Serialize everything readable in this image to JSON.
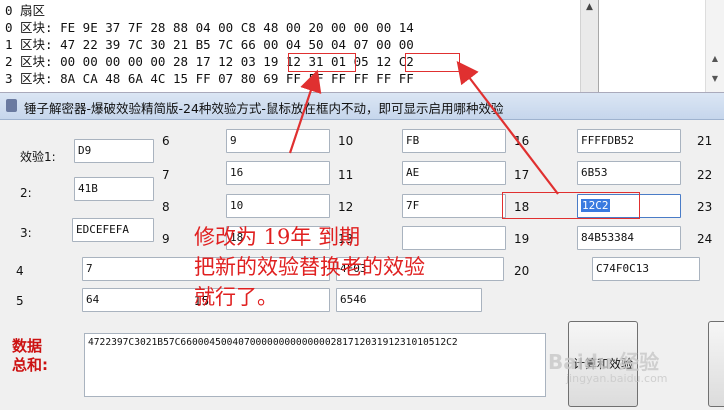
{
  "dump": {
    "lines": [
      "0 扇区",
      "0 区块: FE 9E 37 7F 28 88 04 00 C8 48 00 20 00 00 00 14",
      "1 区块: 47 22 39 7C 30 21 B5 7C 66 00 04 50 04 07 00 00",
      "2 区块: 00 00 00 00 00 28 17 12 03 19 12 31 01 05 12 C2",
      "3 区块: 8A CA 48 6A 4C 15 FF 07 80 69 FF FF FF FF FF FF"
    ]
  },
  "window": {
    "title": "锤子解密器-爆破效验精简版-24种效验方式-鼠标放在框内不动，即可显示启用哪种效验"
  },
  "fields": {
    "f1": {
      "label": "效验1:",
      "value": "D9"
    },
    "f2": {
      "label": "2:",
      "value": "41B"
    },
    "f3": {
      "label": "3:",
      "value": "EDCEFEFA"
    },
    "f4": {
      "label": "4",
      "value": "7"
    },
    "f5": {
      "label": "5",
      "value": "64"
    },
    "f6": {
      "label": "6",
      "value": "9"
    },
    "f7": {
      "label": "7",
      "value": "16"
    },
    "f8": {
      "label": "8",
      "value": "10"
    },
    "f9": {
      "label": "9",
      "value": "18"
    },
    "f10": {
      "label": "10",
      "value": "FB"
    },
    "f11": {
      "label": "11",
      "value": "AE"
    },
    "f12": {
      "label": "12",
      "value": "7F"
    },
    "f13": {
      "label": "13",
      "value": ""
    },
    "f14": {
      "label": "14",
      "value": "4F03"
    },
    "f15": {
      "label": "15",
      "value": "6546"
    },
    "f16": {
      "label": "16",
      "value": "FFFFDB52"
    },
    "f17": {
      "label": "17",
      "value": "6B53"
    },
    "f18": {
      "label": "18",
      "value": "12C2"
    },
    "f19": {
      "label": "19",
      "value": "84B53384"
    },
    "f20": {
      "label": "20",
      "value": "C74F0C13"
    },
    "f21": {
      "label": "21"
    },
    "f22": {
      "label": "22"
    },
    "f23": {
      "label": "23"
    },
    "f24": {
      "label": "24"
    }
  },
  "sum": {
    "label_line1": "数据",
    "label_line2": "总和:",
    "value": "4722397C3021B57C6600045004070000000000000028171203191231010512C2"
  },
  "buttons": {
    "calc_label": "计算和效验"
  },
  "annotation": {
    "line1": "修改为 19年 到期",
    "line2": "把新的效验替换老的效验",
    "line3": "就行了。"
  },
  "watermark": {
    "main": "Baidu 经验",
    "sub": "jingyan.baidu.com"
  },
  "colors": {
    "annotation": "#e02020",
    "selection": "#3a7be0",
    "sum_label": "#cc1111"
  }
}
